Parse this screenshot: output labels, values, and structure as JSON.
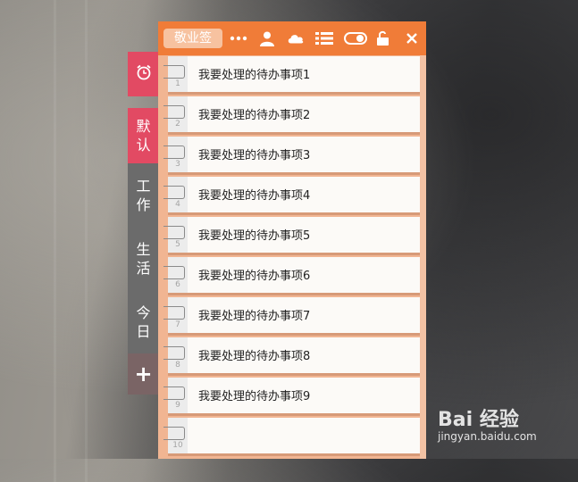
{
  "app": {
    "title": "敬业签"
  },
  "toolbar": {
    "icons": [
      "more-icon",
      "user-icon",
      "cloud-icon",
      "list-icon",
      "toggle-icon",
      "unlock-icon",
      "close-icon"
    ]
  },
  "tabs": {
    "alarm_icon": "alarm-clock-icon",
    "default": "默认",
    "work": "工作",
    "life": "生活",
    "today": "今日",
    "add": "+"
  },
  "todos": [
    {
      "num": "1",
      "text": "我要处理的待办事项1"
    },
    {
      "num": "2",
      "text": "我要处理的待办事项2"
    },
    {
      "num": "3",
      "text": "我要处理的待办事项3"
    },
    {
      "num": "4",
      "text": "我要处理的待办事项4"
    },
    {
      "num": "5",
      "text": "我要处理的待办事项5"
    },
    {
      "num": "6",
      "text": "我要处理的待办事项6"
    },
    {
      "num": "7",
      "text": "我要处理的待办事项7"
    },
    {
      "num": "8",
      "text": "我要处理的待办事项8"
    },
    {
      "num": "9",
      "text": "我要处理的待办事项9"
    },
    {
      "num": "10",
      "text": ""
    }
  ],
  "watermark": {
    "brand": "Bai 经验",
    "url": "jingyan.baidu.com"
  },
  "colors": {
    "toolbar": "#f07c38",
    "panel_bg": "#f1b592",
    "tab_active": "#e24a63",
    "tab_inactive": "#6b6b6b",
    "tab_add": "#7a6465"
  }
}
